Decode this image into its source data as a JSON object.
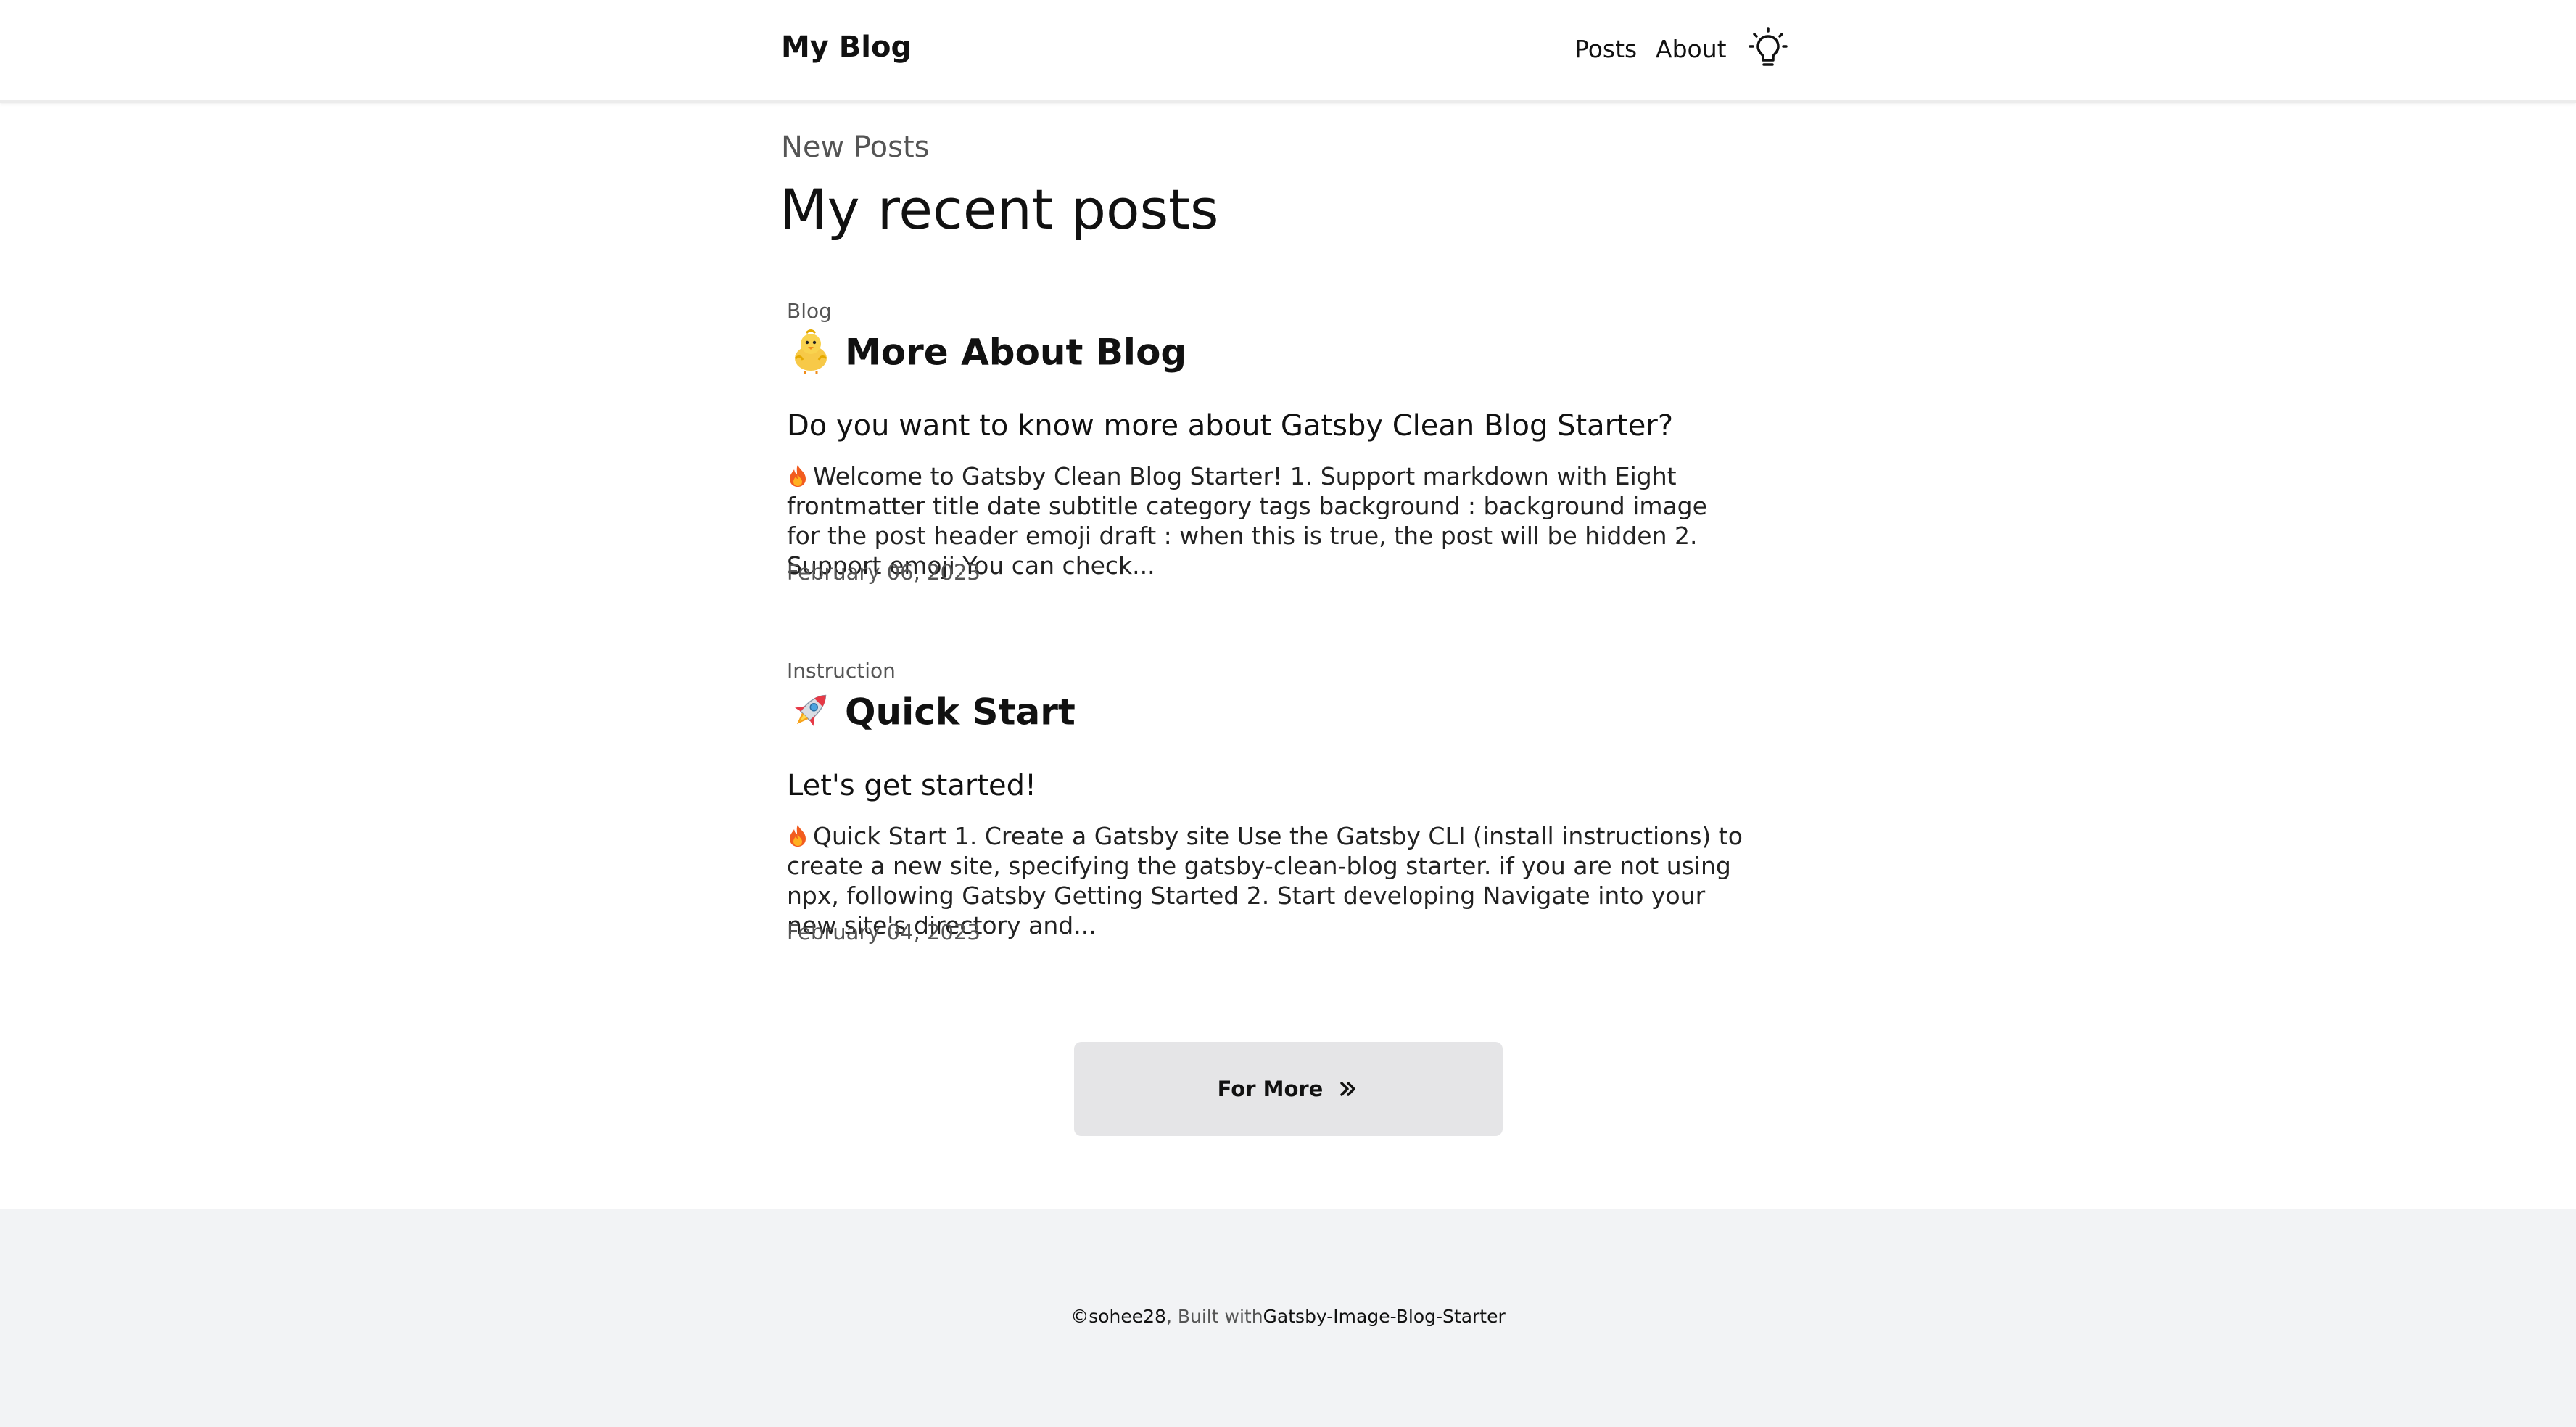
{
  "header": {
    "brand": "My Blog",
    "nav": [
      {
        "label": "Posts"
      },
      {
        "label": "About"
      }
    ],
    "theme_toggle_icon": "lightbulb-icon"
  },
  "main": {
    "section_label": "New Posts",
    "section_title": "My recent posts",
    "posts": [
      {
        "category": "Blog",
        "emoji": "chick-icon",
        "title": "More About Blog",
        "subtitle": "Do you want to know more about Gatsby Clean Blog Starter?",
        "excerpt_icon": "fire-icon",
        "excerpt": "Welcome to Gatsby Clean Blog Starter!   1. Support markdown with Eight frontmatter title date subtitle category tags background : background image for the post header emoji draft : when this is true, the post will be hidden 2. Support emoji You can check...",
        "date": "February 06, 2023"
      },
      {
        "category": "Instruction",
        "emoji": "rocket-icon",
        "title": "Quick Start",
        "subtitle": "Let's get started!",
        "excerpt_icon": "fire-icon",
        "excerpt": "Quick Start 1. Create a Gatsby site Use the Gatsby CLI (install instructions) to create a new site, specifying the gatsby-clean-blog starter. if you are not using npx, following Gatsby Getting Started 2. Start developing Navigate into your new site's directory and...",
        "date": "February 04, 2023"
      }
    ],
    "more_button": {
      "label": "For More",
      "icon": "double-chevron-right-icon"
    }
  },
  "footer": {
    "copyright_symbol": "©",
    "author": "sohee28",
    "built_with": ", Built with",
    "link": "Gatsby-Image-Blog-Starter"
  },
  "colors": {
    "header_border": "#ececec",
    "button_bg": "#e5e5e7",
    "footer_bg": "#f2f3f5",
    "text": "#111111",
    "muted": "#555555"
  }
}
